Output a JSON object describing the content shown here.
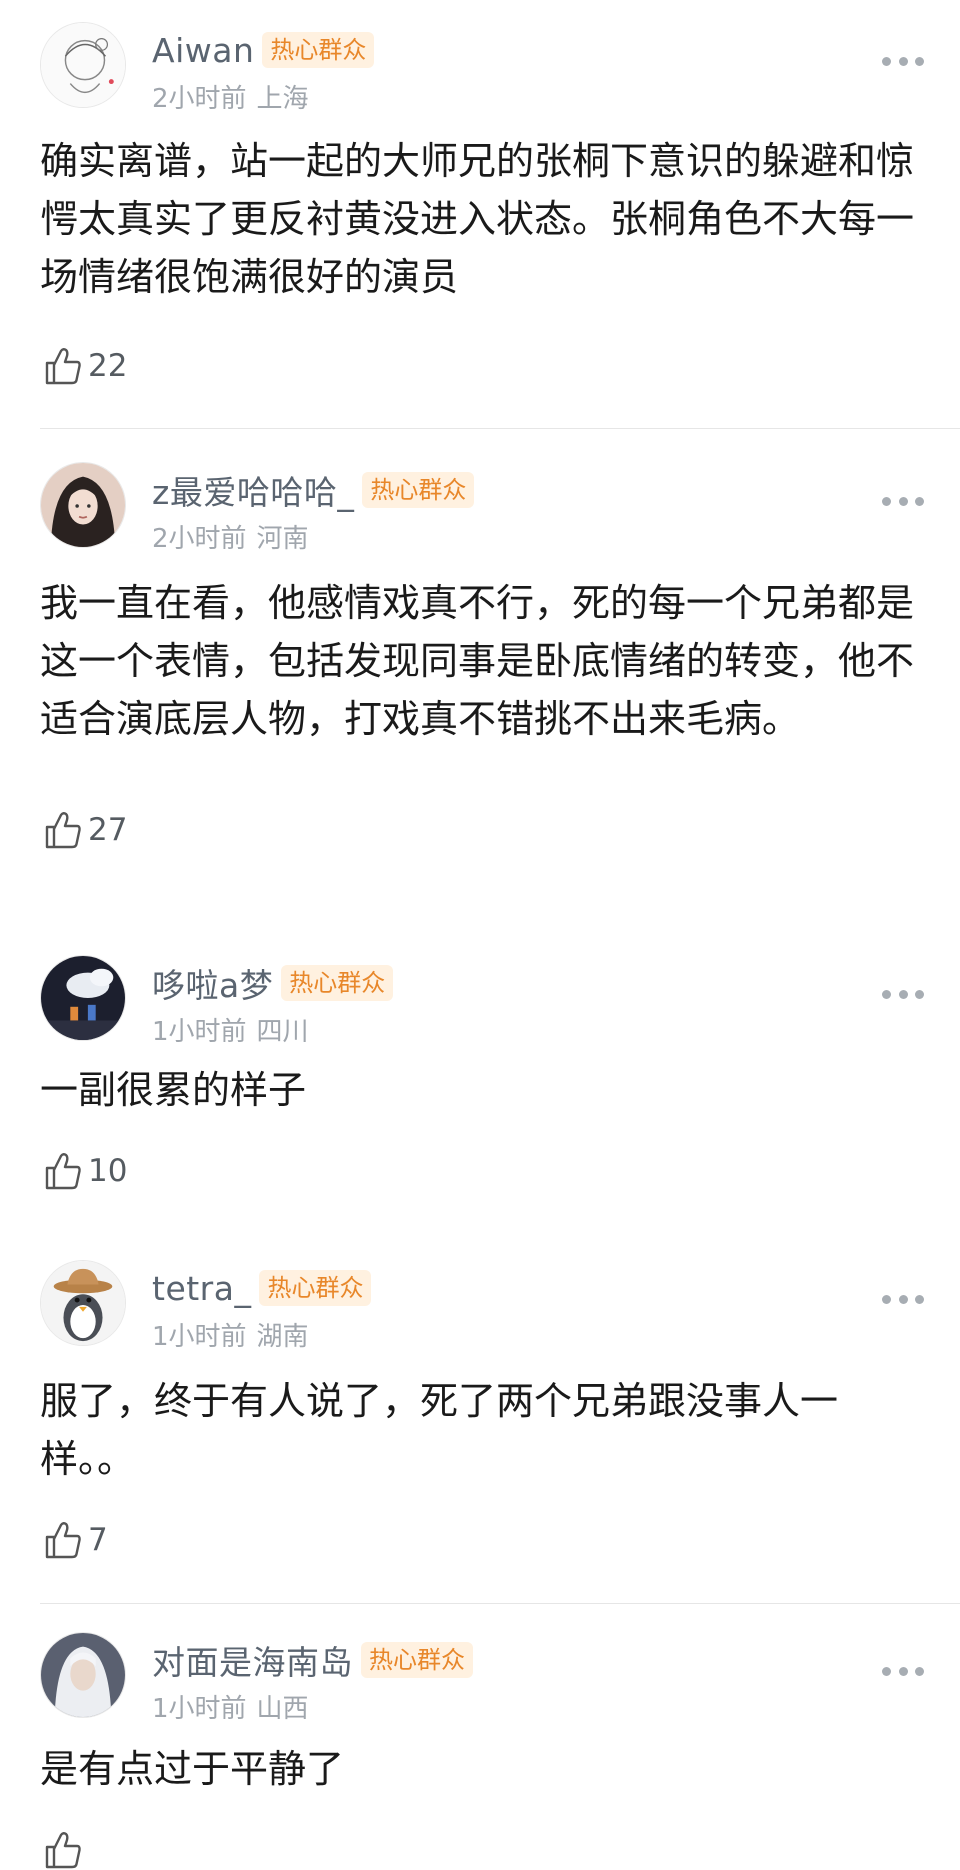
{
  "comments": [
    {
      "username": "Aiwan",
      "badge": "热心群众",
      "time": "2小时前",
      "location": "上海",
      "text": "确实离谱，站一起的大师兄的张桐下意识的躲避和惊愕太真实了更反衬黄没进入状态。张桐角色不大每一场情绪很饱满很好的演员",
      "likes": "22"
    },
    {
      "username": "z最爱哈哈哈_",
      "badge": "热心群众",
      "time": "2小时前",
      "location": "河南",
      "text": "我一直在看，他感情戏真不行，死的每一个兄弟都是这一个表情，包括发现同事是卧底情绪的转变，他不适合演底层人物，打戏真不错挑不出来毛病。",
      "likes": "27"
    },
    {
      "username": "哆啦a梦",
      "badge": "热心群众",
      "time": "1小时前",
      "location": "四川",
      "text": "一副很累的样子",
      "likes": "10"
    },
    {
      "username": "tetra_",
      "badge": "热心群众",
      "time": "1小时前",
      "location": "湖南",
      "text": "服了，终于有人说了，死了两个兄弟跟没事人一样。。",
      "likes": "7"
    },
    {
      "username": "对面是海南岛",
      "badge": "热心群众",
      "time": "1小时前",
      "location": "山西",
      "text": "是有点过于平静了",
      "likes": ""
    }
  ]
}
